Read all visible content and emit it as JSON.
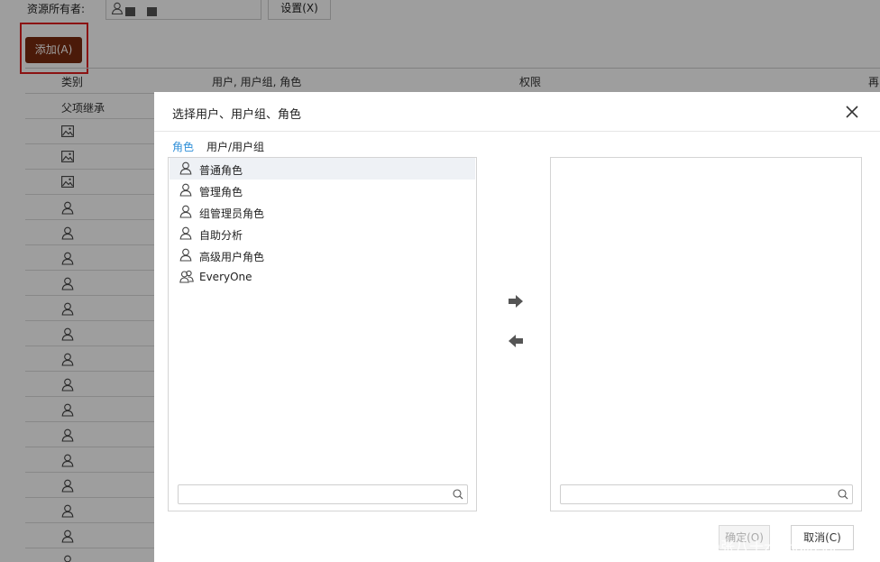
{
  "background": {
    "owner_label": "资源所有者:",
    "owner_button": "设置(X)",
    "add_button": "添加(A)",
    "columns": [
      "类别",
      "用户, 用户组, 角色",
      "权限",
      "再"
    ],
    "first_row_text": "父项继承",
    "row_icons": [
      "image-icon",
      "image-icon",
      "image-icon",
      "user-icon",
      "user-icon",
      "user-icon",
      "user-icon",
      "user-icon",
      "user-icon",
      "user-icon",
      "user-icon",
      "user-icon",
      "user-icon",
      "user-icon",
      "user-icon",
      "user-icon",
      "user-icon",
      "user-icon"
    ]
  },
  "dialog": {
    "title": "选择用户、用户组、角色",
    "tabs": [
      {
        "label": "角色",
        "active": true
      },
      {
        "label": "用户/用户组",
        "active": false
      }
    ],
    "left_list": [
      {
        "label": "普通角色",
        "icon": "user-icon",
        "selected": true
      },
      {
        "label": "管理角色",
        "icon": "user-icon",
        "selected": false
      },
      {
        "label": "组管理员角色",
        "icon": "user-icon",
        "selected": false
      },
      {
        "label": "自助分析",
        "icon": "user-icon",
        "selected": false
      },
      {
        "label": "高级用户角色",
        "icon": "user-icon",
        "selected": false
      },
      {
        "label": "EveryOne",
        "icon": "users-icon",
        "selected": false
      }
    ],
    "left_search_placeholder": "",
    "right_search_placeholder": "",
    "ok_label": "确定(O)",
    "cancel_label": "取消(C)"
  },
  "watermark": "CSDN @张八十zhangliushi",
  "colors": {
    "accent": "#2f8fd8",
    "add_button": "#7a2a10",
    "highlight_frame": "#e02020",
    "selected_row": "#eef1f5"
  }
}
